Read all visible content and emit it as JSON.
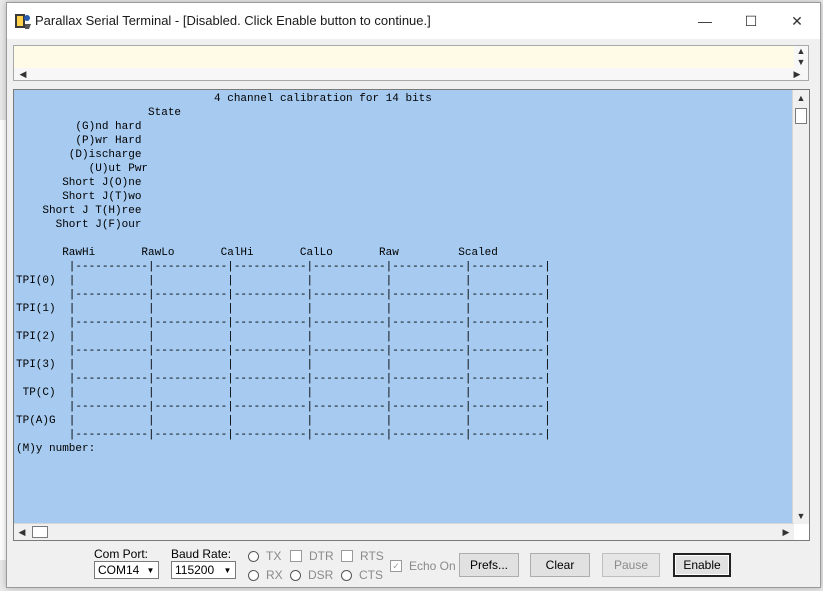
{
  "window": {
    "title": "Parallax Serial Terminal - [Disabled. Click Enable button to continue.]",
    "minimize_glyph": "—",
    "maximize_glyph": "☐",
    "close_glyph": "✕"
  },
  "terminal": {
    "background_color": "#a6caf0",
    "transmit_background_color": "#fffbe6",
    "lines": [
      "                              4 channel calibration for 14 bits",
      "                    State",
      "         (G)nd hard",
      "         (P)wr Hard",
      "        (D)ischarge",
      "           (U)ut Pwr",
      "       Short J(O)ne",
      "       Short J(T)wo",
      "    Short J T(H)ree",
      "      Short J(F)our",
      "",
      "       RawHi       RawLo       CalHi       CalLo       Raw         Scaled",
      "        |-----------|-----------|-----------|-----------|-----------|-----------|",
      "TPI(0)  |           |           |           |           |           |           |",
      "        |-----------|-----------|-----------|-----------|-----------|-----------|",
      "TPI(1)  |           |           |           |           |           |           |",
      "        |-----------|-----------|-----------|-----------|-----------|-----------|",
      "TPI(2)  |           |           |           |           |           |           |",
      "        |-----------|-----------|-----------|-----------|-----------|-----------|",
      "TPI(3)  |           |           |           |           |           |           |",
      "        |-----------|-----------|-----------|-----------|-----------|-----------|",
      " TP(C)  |           |           |           |           |           |           |",
      "        |-----------|-----------|-----------|-----------|-----------|-----------|",
      "TP(A)G  |           |           |           |           |           |           |",
      "        |-----------|-----------|-----------|-----------|-----------|-----------|",
      "(M)y number:"
    ]
  },
  "controls": {
    "com_port_label": "Com Port:",
    "com_port_value": "COM14",
    "baud_rate_label": "Baud Rate:",
    "baud_rate_value": "115200",
    "indicators": {
      "tx": "TX",
      "rx": "RX",
      "dtr": "DTR",
      "dsr": "DSR",
      "rts": "RTS",
      "cts": "CTS"
    },
    "echo_on_label": "Echo On",
    "echo_on_checked": true,
    "buttons": {
      "prefs": "Prefs...",
      "clear": "Clear",
      "pause": "Pause",
      "enable": "Enable"
    }
  }
}
